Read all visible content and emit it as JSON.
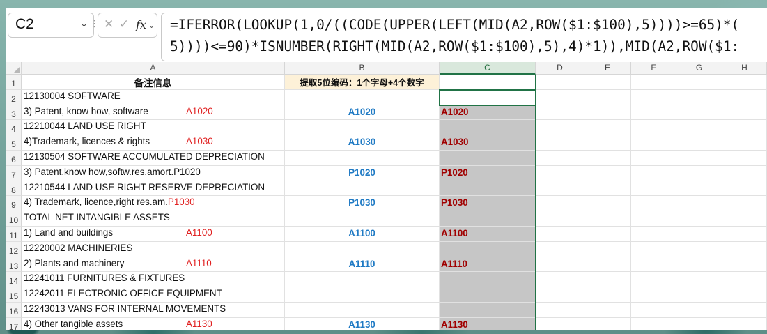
{
  "name_box": "C2",
  "formula_line1": "=IFERROR(LOOKUP(1,0/((CODE(UPPER(LEFT(MID(A2,ROW($1:$100),5))))>=65)*(",
  "formula_line2": "5))))<=90)*ISNUMBER(RIGHT(MID(A2,ROW($1:$100),5),4)*1)),MID(A2,ROW($1:",
  "fx_label": "fx",
  "columns": [
    "A",
    "B",
    "C",
    "D",
    "E",
    "F",
    "G",
    "H"
  ],
  "header_row": {
    "a": "备注信息",
    "b": "提取5位编码：1个字母+4个数字",
    "c": ""
  },
  "rows": [
    {
      "n": "1"
    },
    {
      "n": "2",
      "a_text": "12130004 SOFTWARE",
      "a_code": "",
      "b": "",
      "c": ""
    },
    {
      "n": "3",
      "a_text": "3) Patent, know how, software",
      "a_code": "A1020",
      "b": "A1020",
      "c": "A1020"
    },
    {
      "n": "4",
      "a_text": "12210044 LAND USE RIGHT",
      "a_code": "",
      "b": "",
      "c": ""
    },
    {
      "n": "5",
      "a_text": "4)Trademark, licences & rights",
      "a_code": "A1030",
      "b": "A1030",
      "c": "A1030"
    },
    {
      "n": "6",
      "a_text": "12130504 SOFTWARE ACCUMULATED DEPRECIATION",
      "a_code": "",
      "b": "",
      "c": ""
    },
    {
      "n": "7",
      "a_text": "3) Patent,know how,softw.res.amort.P1020",
      "a_code": "",
      "b": "P1020",
      "c": "P1020"
    },
    {
      "n": "8",
      "a_text": "12210544 LAND USE RIGHT RESERVE DEPRECIATION",
      "a_code": "",
      "b": "",
      "c": ""
    },
    {
      "n": "9",
      "a_text": "4) Trademark, licence,right res.am.",
      "a_code": "P1030",
      "b": "P1030",
      "c": "P1030"
    },
    {
      "n": "10",
      "a_text": "TOTAL NET INTANGIBLE ASSETS",
      "a_code": "",
      "b": "",
      "c": ""
    },
    {
      "n": "11",
      "a_text": "1) Land and buildings",
      "a_code": "A1100",
      "b": "A1100",
      "c": "A1100"
    },
    {
      "n": "12",
      "a_text": "12220002 MACHINERIES",
      "a_code": "",
      "b": "",
      "c": ""
    },
    {
      "n": "13",
      "a_text": "2) Plants and machinery",
      "a_code": "A1110",
      "b": "A1110",
      "c": "A1110"
    },
    {
      "n": "14",
      "a_text": "12241011 FURNITURES & FIXTURES",
      "a_code": "",
      "b": "",
      "c": ""
    },
    {
      "n": "15",
      "a_text": "12242011 ELECTRONIC OFFICE EQUIPMENT",
      "a_code": "",
      "b": "",
      "c": ""
    },
    {
      "n": "16",
      "a_text": "12243013 VANS FOR INTERNAL MOVEMENTS",
      "a_code": "",
      "b": "",
      "c": ""
    },
    {
      "n": "17",
      "a_text": "4) Other tangible assets",
      "a_code": "A1130",
      "b": "A1130",
      "c": "A1130"
    }
  ]
}
